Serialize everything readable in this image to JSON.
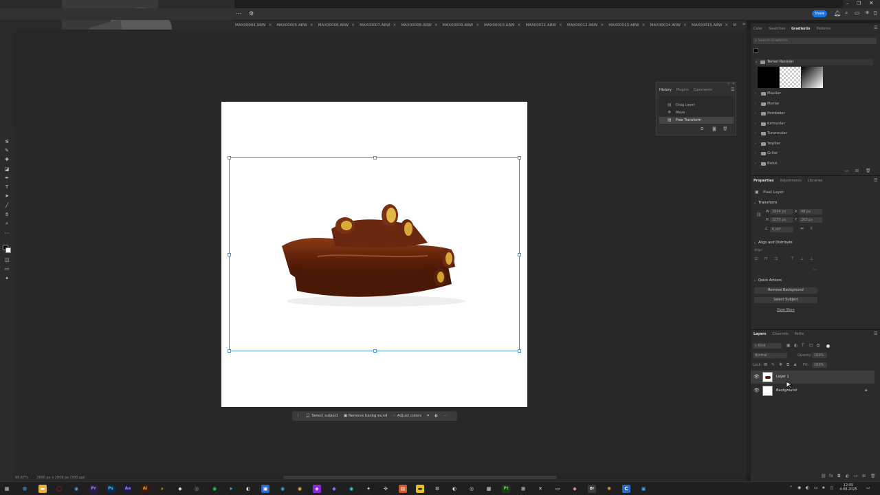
{
  "tabs": [
    "MAX00004.ARW",
    "MAX00005.ARW",
    "MAX00006.ARW",
    "MAX00007.ARW",
    "MAX00008.ARW",
    "MAX00009.ARW",
    "MAX00010.ARW",
    "MAX00011.ARW",
    "MAX00012.ARW",
    "MAX00013.ARW",
    "MAX00014.ARW",
    "MAX00015.ARW",
    "M"
  ],
  "tab_close": "×",
  "topbar": {
    "share_label": "Share"
  },
  "context_bar": {
    "select_subject": "Select subject",
    "remove_background": "Remove background",
    "adjust_colors": "Adjust colors"
  },
  "statusbar": {
    "zoom": "66,67%",
    "doc_info": "2900 px x 2009 px (300 ppi)"
  },
  "history": {
    "tabs": [
      "History",
      "Plugins",
      "Comments"
    ],
    "items": [
      "Drag Layer",
      "Move",
      "Free Transform"
    ]
  },
  "gradients_panel": {
    "tabs": [
      "Color",
      "Swatches",
      "Gradients",
      "Patterns"
    ],
    "search_placeholder": "Search Gradients",
    "folders": [
      "Temel Renkler",
      "Maviler",
      "Morlar",
      "Pembeler",
      "Kırmızılar",
      "Turuncular",
      "Yeşiller",
      "Griler",
      "Bulut"
    ]
  },
  "properties_panel": {
    "tabs": [
      "Properties",
      "Adjustments",
      "Libraries"
    ],
    "layer_type": "Pixel Layer",
    "transform_title": "Transform",
    "w_label": "W",
    "w_value": "3904 px",
    "h_label": "H",
    "h_value": "3270 px",
    "x_label": "X",
    "x_value": "48 px",
    "y_label": "Y",
    "y_value": "263 px",
    "angle_value": "0,00°",
    "align_title": "Align and Distribute",
    "align_label": "Align:",
    "quick_actions_title": "Quick Actions",
    "remove_bg_btn": "Remove Background",
    "select_subject_btn": "Select Subject",
    "view_more": "View More"
  },
  "layers_panel": {
    "tabs": [
      "Layers",
      "Channels",
      "Paths"
    ],
    "kind_label": "Kind",
    "blend_mode": "Normal",
    "opacity_label": "Opacity:",
    "opacity_value": "100%",
    "lock_label": "Lock:",
    "fill_label": "Fill:",
    "fill_value": "100%",
    "layers": [
      {
        "name": "Layer 1"
      },
      {
        "name": "Background"
      }
    ]
  },
  "taskbar": {
    "time": "12:05",
    "date": "4.08.2025",
    "apps": [
      "Pr",
      "Ps",
      "Ae",
      "Ai",
      "Pt",
      "Dr"
    ]
  },
  "colors": {
    "accent": "#1473e6",
    "selection": "#4a8fd8"
  }
}
